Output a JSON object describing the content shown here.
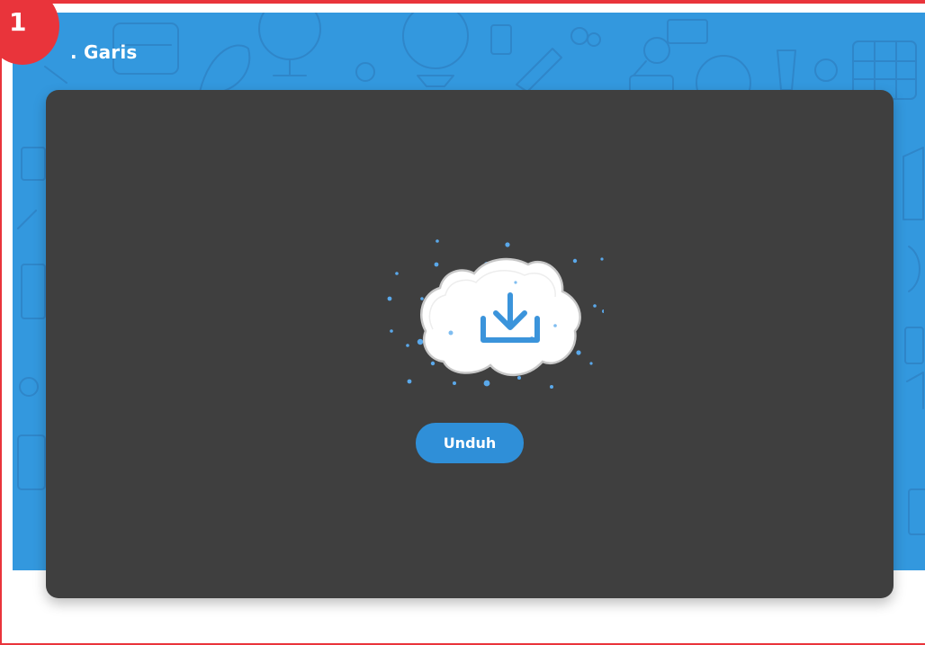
{
  "header": {
    "step_number": "1",
    "title": ". Garis"
  },
  "card": {
    "icon": "cloud-download-icon",
    "download_label": "Unduh"
  },
  "colors": {
    "frame_border": "#e9343b",
    "hero_background": "#3398de",
    "card_background": "#3f3f3f",
    "accent": "#2f8fd8",
    "cloud": "#ffffff"
  }
}
